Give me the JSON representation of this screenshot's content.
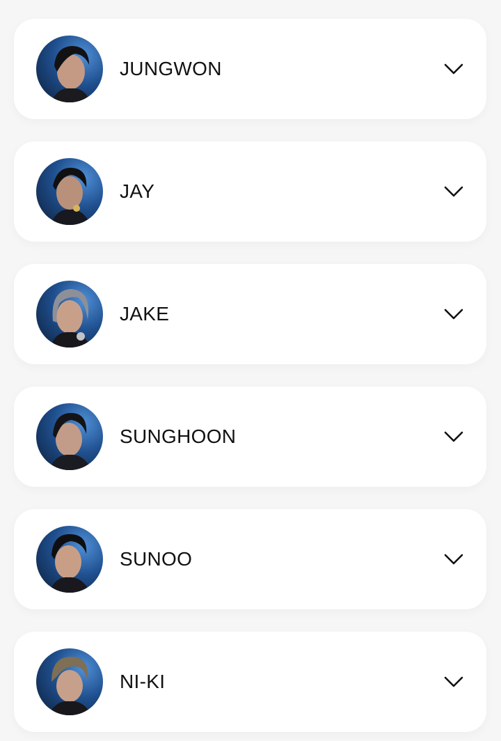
{
  "members": [
    {
      "name": "JUNGWON",
      "icon": "chevron-down-icon"
    },
    {
      "name": "JAY",
      "icon": "chevron-down-icon"
    },
    {
      "name": "JAKE",
      "icon": "chevron-down-icon"
    },
    {
      "name": "SUNGHOON",
      "icon": "chevron-down-icon"
    },
    {
      "name": "SUNOO",
      "icon": "chevron-down-icon"
    },
    {
      "name": "NI-KI",
      "icon": "chevron-down-icon"
    }
  ],
  "colors": {
    "background": "#f6f6f6",
    "card": "#ffffff",
    "text": "#111111",
    "avatar_accent": "#4f8fd6"
  }
}
